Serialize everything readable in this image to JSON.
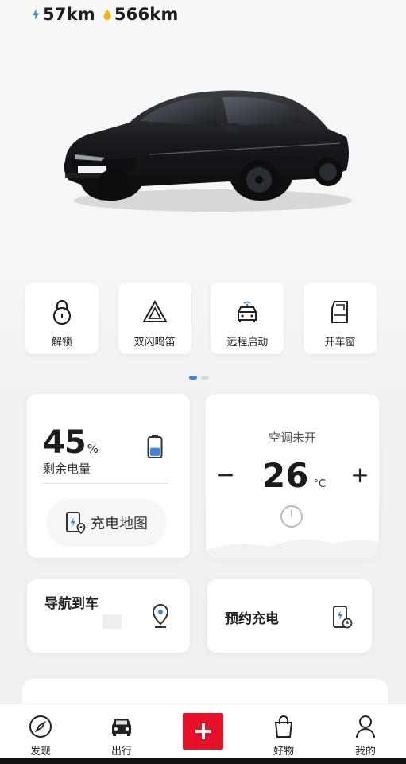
{
  "header": {
    "electric_range": "57km",
    "fuel_range": "566km",
    "electric_icon": "bolt-icon",
    "fuel_icon": "fuel-drop-icon"
  },
  "quick_actions": [
    {
      "label": "解锁",
      "icon": "unlock-icon"
    },
    {
      "label": "双闪鸣笛",
      "icon": "hazard-triangle-icon"
    },
    {
      "label": "远程启动",
      "icon": "remote-start-car-icon"
    },
    {
      "label": "开车窗",
      "icon": "car-window-icon"
    }
  ],
  "pager": {
    "pages": 2,
    "active": 1
  },
  "battery": {
    "percent": "45",
    "unit": "%",
    "level": 0.45,
    "label": "剩余电量",
    "charge_map_label": "充电地图"
  },
  "ac": {
    "status": "空调未开",
    "minus": "−",
    "plus": "+",
    "temperature": "26",
    "unit": "°C"
  },
  "navigate": {
    "title": "导航到车"
  },
  "reserve_charge": {
    "title": "预约充电"
  },
  "tabbar": {
    "items": [
      {
        "label": "发现",
        "icon": "compass-icon"
      },
      {
        "label": "出行",
        "icon": "car-front-icon"
      },
      {
        "label": "",
        "icon": "plus-icon"
      },
      {
        "label": "好物",
        "icon": "shopping-bag-icon"
      },
      {
        "label": "我的",
        "icon": "user-icon"
      }
    ]
  },
  "colors": {
    "accent_blue": "#3b86e0",
    "brand_red": "#e5102a",
    "fuel_yellow": "#f5b400"
  }
}
